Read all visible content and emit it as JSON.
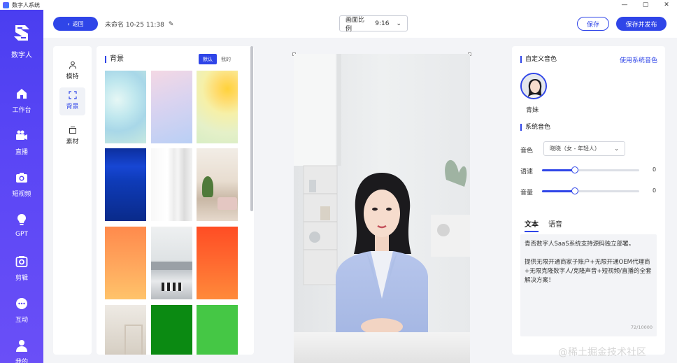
{
  "window": {
    "title": "数字人系统",
    "buttons": [
      "—",
      "▢",
      "✕"
    ]
  },
  "sidebar": {
    "logo_text": "数字人",
    "items": [
      {
        "label": "工作台",
        "icon": "home-icon"
      },
      {
        "label": "直播",
        "icon": "video-camera-icon"
      },
      {
        "label": "短视频",
        "icon": "camera-icon"
      },
      {
        "label": "GPT",
        "icon": "lightbulb-icon"
      },
      {
        "label": "剪辑",
        "icon": "photo-icon"
      },
      {
        "label": "互动",
        "icon": "chat-icon"
      },
      {
        "label": "我的",
        "icon": "user-icon"
      }
    ]
  },
  "topbar": {
    "back_label": "返回",
    "draft_title": "未命名 10-25 11:38",
    "ratio_label": "画面比例",
    "ratio_value": "9:16",
    "save_label": "保存",
    "publish_label": "保存并发布"
  },
  "tools": [
    {
      "label": "模特",
      "icon": "person-icon",
      "active": false
    },
    {
      "label": "背景",
      "icon": "frame-icon",
      "active": true
    },
    {
      "label": "素材",
      "icon": "layers-icon",
      "active": false
    }
  ],
  "background_panel": {
    "title": "背景",
    "segments": [
      "默认",
      "我的"
    ],
    "active_segment": "默认",
    "thumbnails": [
      "pastel-blue-green",
      "pastel-pink-blue",
      "yellow-sun",
      "deep-blue",
      "white-curtain",
      "living-room",
      "orange-gradient",
      "kitchen",
      "red-orange-gradient",
      "shelf-room",
      "dark-green",
      "bright-green"
    ]
  },
  "right_panel": {
    "custom_voice_title": "自定义音色",
    "use_system_voice_link": "使用系统音色",
    "avatar_name": "青妹",
    "system_voice_title": "系统音色",
    "voice_label": "音色",
    "voice_value": "晓晓（女 - 年轻人）",
    "speed_label": "语速",
    "speed_value": "0",
    "volume_label": "音量",
    "volume_value": "0",
    "tabs": [
      "文本",
      "语音"
    ],
    "active_tab": "文本",
    "text_lines": [
      "青否数字人SaaS系统支持源码独立部署。",
      "提供无限开通商家子账户+无限开通OEM代理商+无限克隆数字人/克隆声音+短视频/直播的全套解决方案！"
    ],
    "char_count": "72/10000"
  },
  "watermark": "@稀土掘金技术社区",
  "colors": {
    "accent": "#2f45e8",
    "sidebar": "#4a3ef0"
  }
}
